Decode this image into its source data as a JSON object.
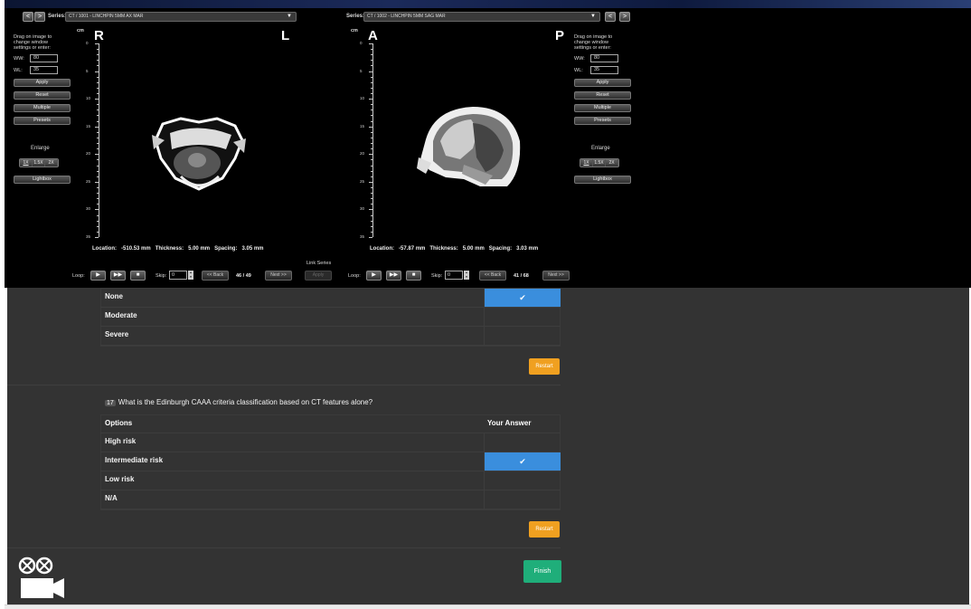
{
  "viewer": {
    "left": {
      "nav_prev": "<",
      "nav_next": ">",
      "series_label": "Series:",
      "series_value": "CT / 1001 - LINCHPIN 5MM AX MAR",
      "orient_left": "R",
      "orient_right": "L",
      "instructions": "Drag on image to change window settings or enter:",
      "ww_label": "WW:",
      "ww_value": "80",
      "wl_label": "WL:",
      "wl_value": "35",
      "buttons": [
        "Apply",
        "Reset",
        "Multiple",
        "Presets"
      ],
      "enlarge_label": "Enlarge",
      "enlarge_options": [
        "1X",
        "1.5X",
        "2X"
      ],
      "lightbox": "Lightbox",
      "cm": "cm",
      "ruler": [
        "0",
        "5",
        "10",
        "15",
        "20",
        "25",
        "30",
        "35"
      ],
      "location_label": "Location:",
      "location_value": "-510.53 mm",
      "thickness_label": "Thickness:",
      "thickness_value": "5.00 mm",
      "spacing_label": "Spacing:",
      "spacing_value": "3.05 mm",
      "loop_label": "Loop:",
      "skip_label": "Skip:",
      "skip_value": "0",
      "back": "<< Back",
      "next": "Next >>",
      "counter": "46 / 49"
    },
    "right": {
      "nav_prev": "<",
      "nav_next": ">",
      "series_label": "Series:",
      "series_value": "CT / 1002 - LINCHPIN 5MM SAG MAR",
      "orient_left": "A",
      "orient_right": "P",
      "instructions": "Drag on image to change window settings or enter:",
      "ww_label": "WW:",
      "ww_value": "80",
      "wl_label": "WL:",
      "wl_value": "35",
      "buttons": [
        "Apply",
        "Reset",
        "Multiple",
        "Presets"
      ],
      "enlarge_label": "Enlarge",
      "enlarge_options": [
        "1X",
        "1.5X",
        "2X"
      ],
      "lightbox": "Lightbox",
      "cm": "cm",
      "ruler": [
        "0",
        "5",
        "10",
        "15",
        "20",
        "25",
        "30",
        "35"
      ],
      "location_label": "Location:",
      "location_value": "-57.87 mm",
      "thickness_label": "Thickness:",
      "thickness_value": "5.00 mm",
      "spacing_label": "Spacing:",
      "spacing_value": "3.03 mm",
      "loop_label": "Loop:",
      "skip_label": "Skip:",
      "skip_value": "0",
      "back": "<< Back",
      "next": "Next >>",
      "counter": "41 / 68"
    },
    "link_series": "Link Series",
    "link_apply": "Apply",
    "play_icons": [
      "▶",
      "▶▶",
      "■"
    ]
  },
  "quiz": {
    "q16": {
      "options": [
        "None",
        "Moderate",
        "Severe"
      ],
      "selected_index": 0,
      "restart": "Restart"
    },
    "q17": {
      "number": "17",
      "question": "What is the Edinburgh CAAA criteria classification based on CT features alone?",
      "col_options": "Options",
      "col_answer": "Your Answer",
      "options": [
        "High risk",
        "Intermediate risk",
        "Low risk",
        "N/A"
      ],
      "selected_index": 1,
      "restart": "Restart"
    },
    "check_mark": "✔",
    "finish": "Finish"
  },
  "colors": {
    "selected": "#3a8edd",
    "restart": "#f0a020",
    "finish": "#1fae7a",
    "quiz_bg": "#333333"
  },
  "icons": [
    "camera-icon"
  ]
}
